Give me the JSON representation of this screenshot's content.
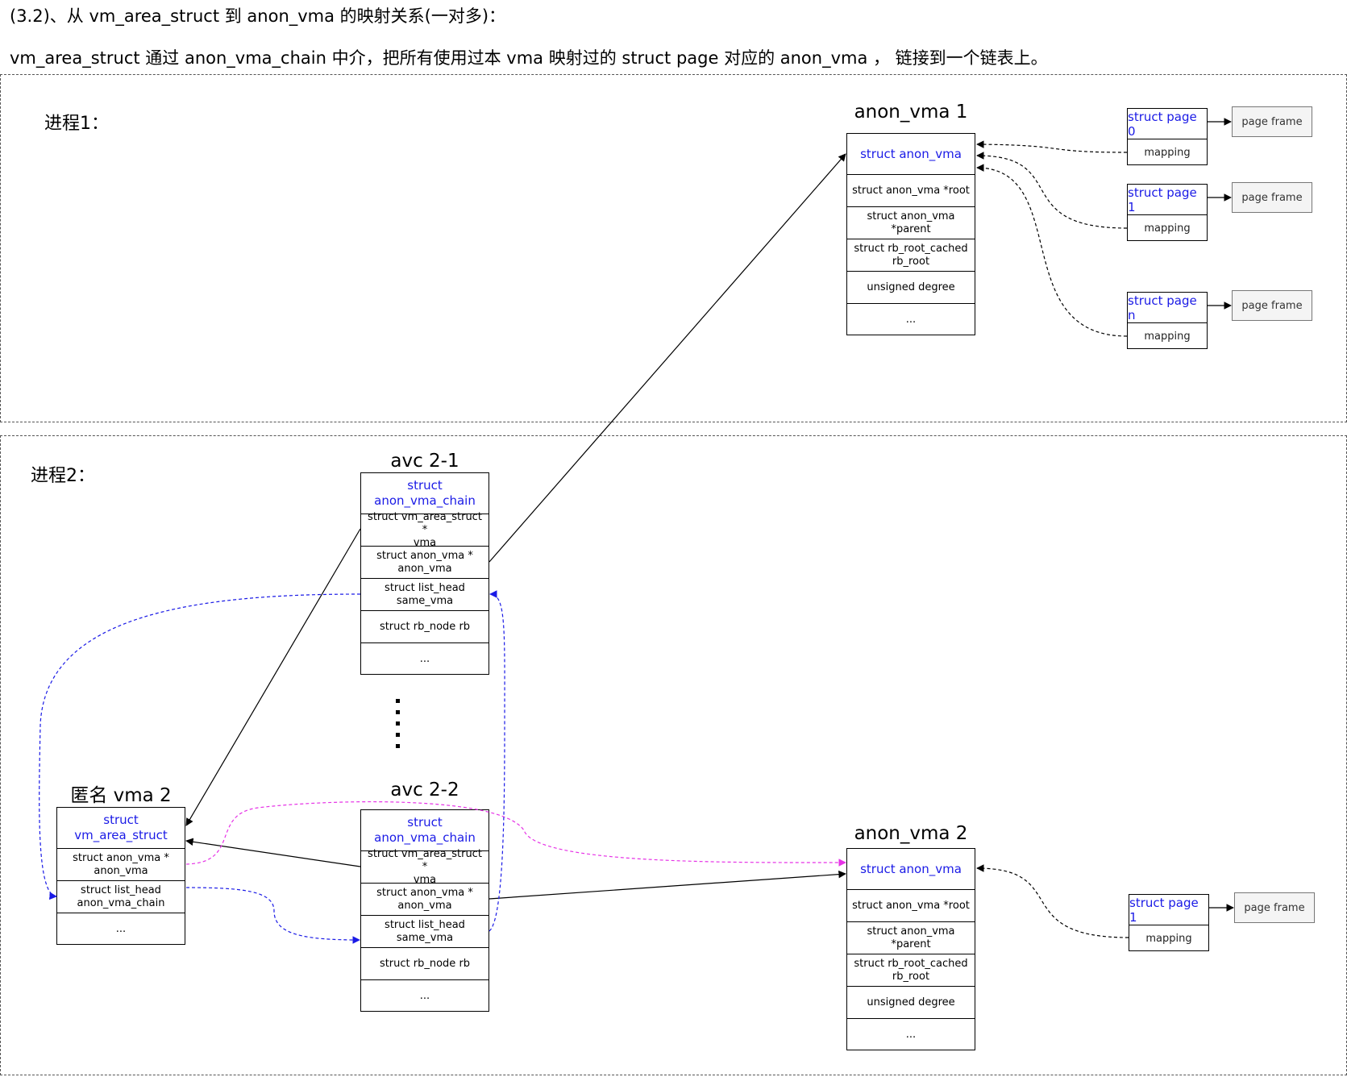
{
  "heading": {
    "line1": "(3.2)、从 vm_area_struct 到 anon_vma 的映射关系(一对多)：",
    "line2": "vm_area_struct 通过 anon_vma_chain 中介，把所有使用过本 vma 映射过的 struct page 对应的 anon_vma ， 链接到一个链表上。"
  },
  "process1": {
    "label": "进程1：",
    "anon_vma": {
      "title": "anon_vma 1",
      "rows": [
        "struct anon_vma",
        "struct anon_vma *root",
        "struct anon_vma *parent",
        "struct rb_root_cached\nrb_root",
        "unsigned degree",
        "..."
      ]
    },
    "pages": [
      {
        "name": "struct page 0",
        "mapping": "mapping",
        "frame": "page frame"
      },
      {
        "name": "struct page 1",
        "mapping": "mapping",
        "frame": "page frame"
      },
      {
        "name": "struct page n",
        "mapping": "mapping",
        "frame": "page frame"
      }
    ]
  },
  "process2": {
    "label": "进程2：",
    "avc1": {
      "title": "avc 2-1",
      "rows": [
        "struct\nanon_vma_chain",
        "struct vm_area_struct *\nvma",
        "struct anon_vma *\nanon_vma",
        "struct list_head\nsame_vma",
        "struct rb_node rb",
        "..."
      ]
    },
    "avc2": {
      "title": "avc 2-2",
      "rows": [
        "struct\nanon_vma_chain",
        "struct vm_area_struct *\nvma",
        "struct anon_vma *\nanon_vma",
        "struct list_head\nsame_vma",
        "struct rb_node rb",
        "..."
      ]
    },
    "vma": {
      "title": "匿名 vma 2",
      "rows": [
        "struct vm_area_struct",
        "struct anon_vma *\nanon_vma",
        "struct list_head\nanon_vma_chain",
        "..."
      ]
    },
    "anon_vma": {
      "title": "anon_vma 2",
      "rows": [
        "struct anon_vma",
        "struct anon_vma *root",
        "struct anon_vma *parent",
        "struct rb_root_cached\nrb_root",
        "unsigned degree",
        "..."
      ]
    },
    "pages": [
      {
        "name": "struct page 1",
        "mapping": "mapping",
        "frame": "page frame"
      }
    ]
  },
  "colors": {
    "struct_head": "#1a1ae6",
    "list_link": "#1a1ae6",
    "anon_link": "#e632e6",
    "pointer": "#000000",
    "mapping_link": "#000000"
  }
}
